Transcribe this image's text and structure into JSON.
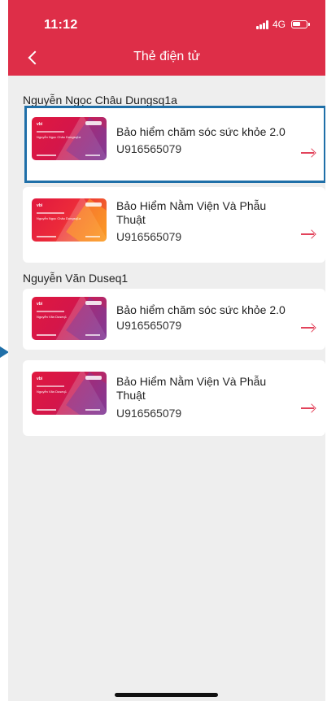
{
  "status_bar": {
    "time": "11:12",
    "network": "4G"
  },
  "header": {
    "title": "Thẻ điện tử"
  },
  "groups": [
    {
      "name": "Nguyễn Ngọc Châu Dungsq1a",
      "cards": [
        {
          "title": "Bảo hiểm chăm sóc sức khỏe 2.0",
          "code": "U916565079",
          "thumb_name": "Nguyễn Ngọc Châu Dungsq1a",
          "style": "purple",
          "selected": true
        },
        {
          "title": "Bảo Hiểm Nằm Viện Và Phẫu Thuật",
          "code": "U916565079",
          "thumb_name": "Nguyễn Ngọc Châu Dungsq1a",
          "style": "orange",
          "selected": false
        }
      ]
    },
    {
      "name": "Nguyễn Văn Duseq1",
      "cards": [
        {
          "title": "Bảo hiểm chăm sóc sức khỏe 2.0",
          "code": "U916565079",
          "thumb_name": "Nguyễn Văn Duseq1",
          "style": "purple",
          "selected": false
        },
        {
          "title": "Bảo Hiểm Nằm Viện Và Phẫu Thuật",
          "code": "U916565079",
          "thumb_name": "Nguyễn Văn Duseq1",
          "style": "purple",
          "selected": false
        }
      ]
    }
  ],
  "colors": {
    "accent": "#de2e48",
    "selection_outline": "#1f6fa8",
    "arrow": "#e2435b"
  },
  "icons": {
    "back": "chevron-left-icon",
    "arrow": "arrow-right-icon",
    "signal": "signal-icon",
    "battery": "battery-icon"
  }
}
